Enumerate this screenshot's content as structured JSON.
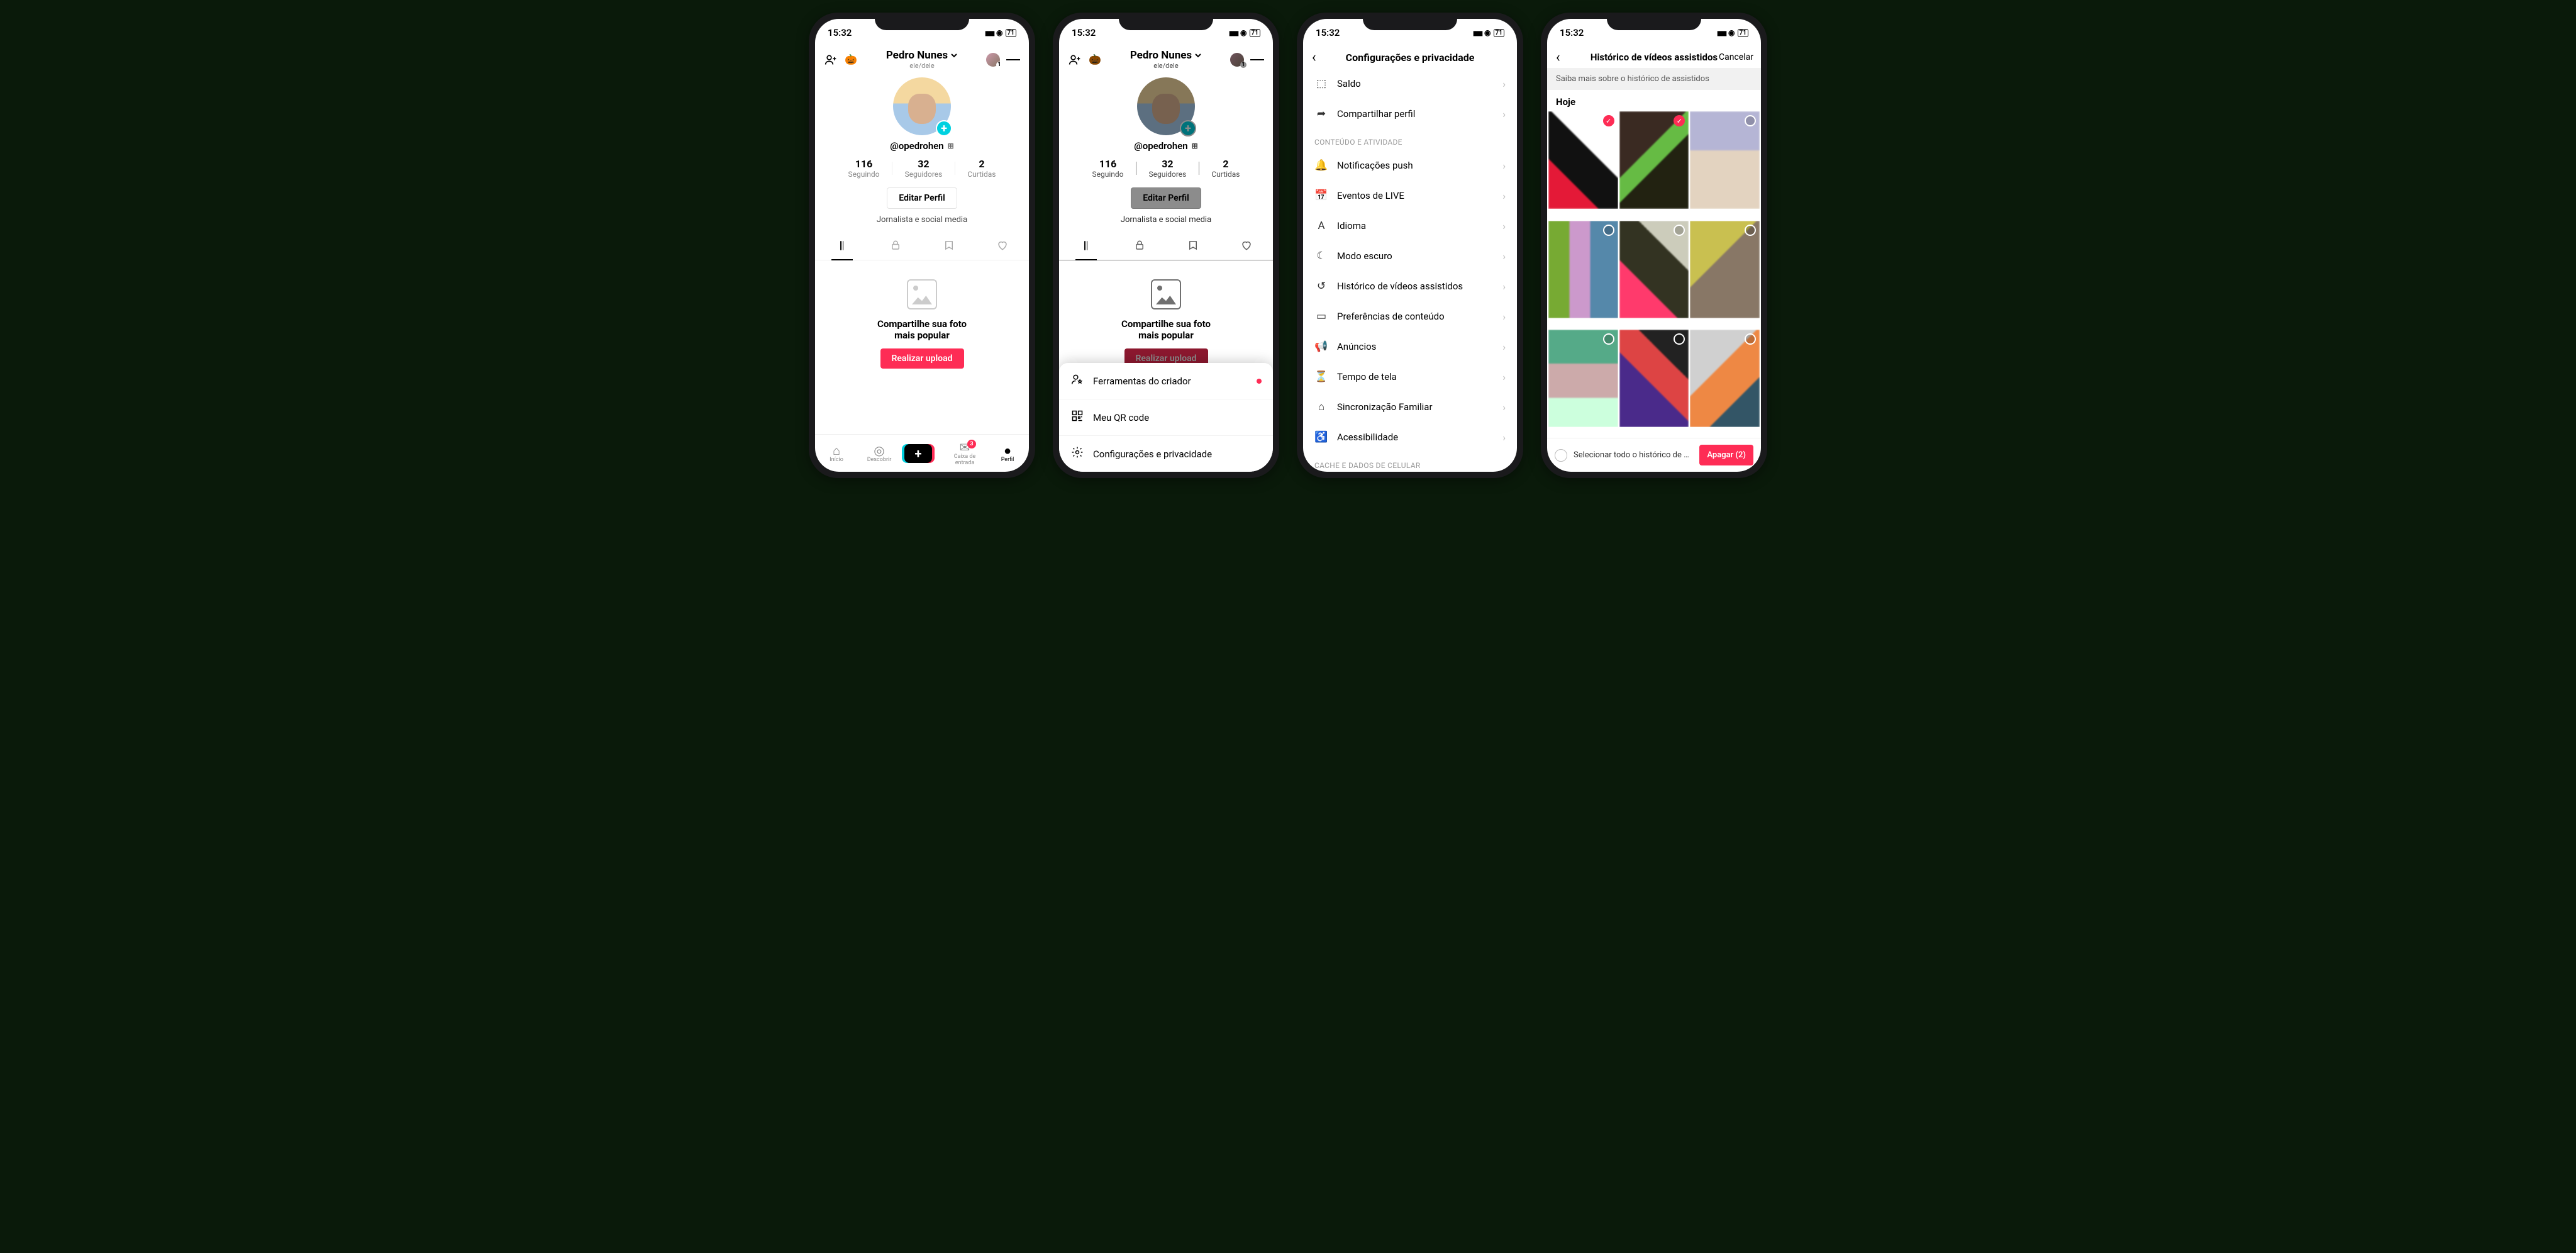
{
  "status": {
    "time": "15:32",
    "battery": "71"
  },
  "profile": {
    "name": "Pedro Nunes",
    "pronouns": "ele/dele",
    "handle": "@opedrohen",
    "stats": {
      "following_n": "116",
      "following_l": "Seguindo",
      "followers_n": "32",
      "followers_l": "Seguidores",
      "likes_n": "2",
      "likes_l": "Curtidas"
    },
    "edit_btn": "Editar Perfil",
    "bio": "Jornalista e social media",
    "empty_title_1": "Compartilhe sua foto",
    "empty_title_2": "mais popular",
    "upload_btn": "Realizar upload"
  },
  "nav": {
    "home": "Início",
    "discover": "Descobrir",
    "inbox": "Caixa de entrada",
    "inbox_badge": "3",
    "profile": "Perfil"
  },
  "sheet": {
    "creator": "Ferramentas do criador",
    "qr": "Meu QR code",
    "settings": "Configurações e privacidade"
  },
  "settings": {
    "title": "Configurações e privacidade",
    "balance": "Saldo",
    "share": "Compartilhar perfil",
    "section_content": "CONTEÚDO E ATIVIDADE",
    "push": "Notificações push",
    "live": "Eventos de LIVE",
    "lang": "Idioma",
    "dark": "Modo escuro",
    "history": "Histórico de vídeos assistidos",
    "pref": "Preferências de conteúdo",
    "ads": "Anúncios",
    "screen_time": "Tempo de tela",
    "family": "Sincronização Familiar",
    "access": "Acessibilidade",
    "section_cache": "CACHE E DADOS DE CELULAR"
  },
  "history": {
    "title": "Histórico de vídeos assistidos",
    "cancel": "Cancelar",
    "info": "Saiba mais sobre o histórico de assistidos",
    "today": "Hoje",
    "select_all": "Selecionar todo o histórico de assis...",
    "delete_btn": "Apagar (2)"
  }
}
